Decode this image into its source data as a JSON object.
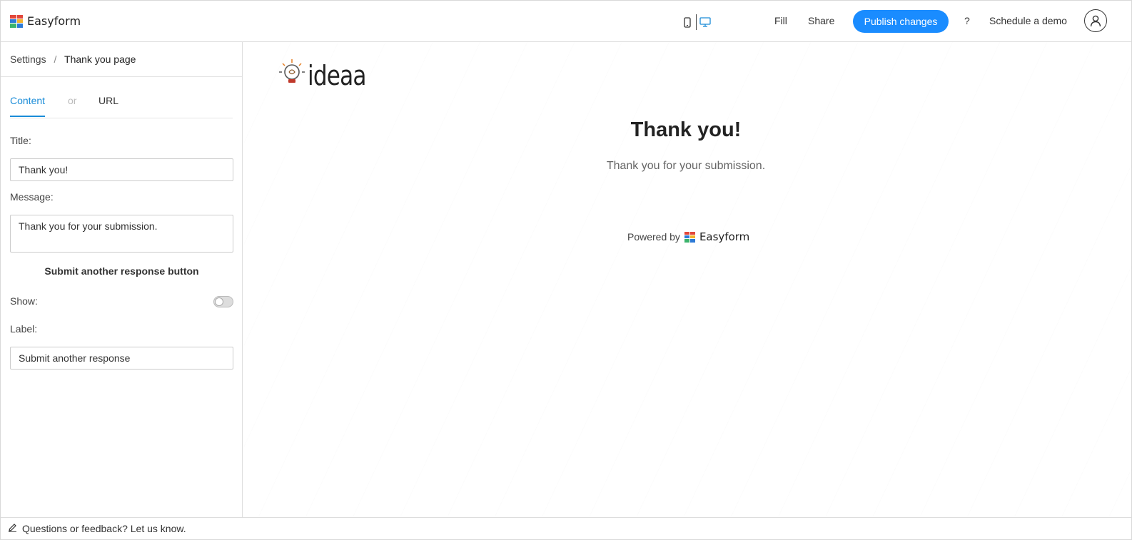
{
  "header": {
    "app_name": "Easyform",
    "device_icons": [
      "mobile-icon",
      "desktop-icon"
    ],
    "fill_label": "Fill",
    "share_label": "Share",
    "publish_label": "Publish changes",
    "help_label": "?",
    "demo_label": "Schedule a demo",
    "accent_color": "#1a8cff"
  },
  "sidebar": {
    "breadcrumb": {
      "root": "Settings",
      "separator": "/",
      "current": "Thank you page"
    },
    "tabs": {
      "content": "Content",
      "or": "or",
      "url": "URL",
      "active": "Content"
    },
    "title_label": "Title",
    "title_value": "Thank you!",
    "message_label": "Message",
    "message_value": "Thank you for your submission.",
    "section_title": "Submit another response button",
    "show_label": "Show",
    "show_enabled": false,
    "label_label": "Label",
    "label_value": "Submit another response"
  },
  "preview": {
    "logo_text": "ideaa",
    "title": "Thank you!",
    "message": "Thank you for your submission.",
    "powered_by": "Powered by",
    "powered_brand": "Easyform"
  },
  "footer": {
    "feedback_text": "Questions or feedback? Let us know.",
    "icon": "pencil-icon"
  }
}
